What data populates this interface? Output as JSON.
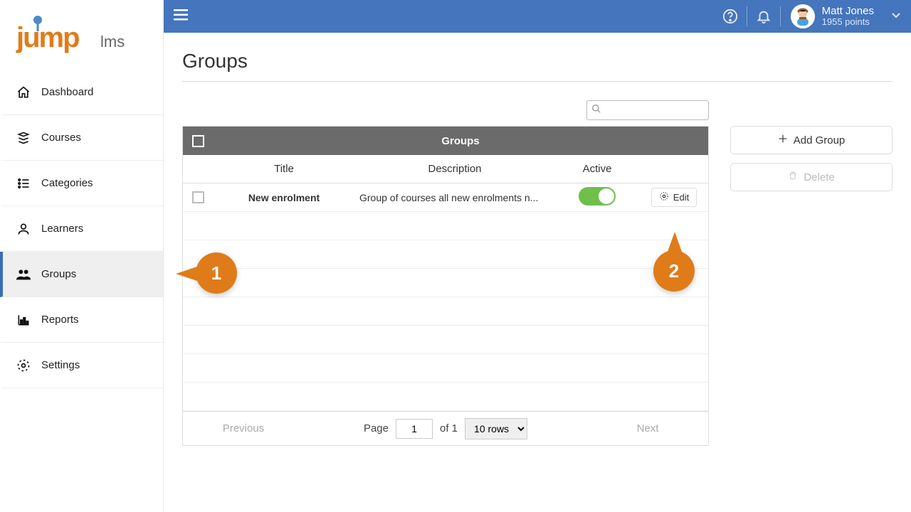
{
  "brand": {
    "name": "jump",
    "suffix": "lms"
  },
  "sidebar": {
    "items": [
      {
        "label": "Dashboard",
        "icon": "home"
      },
      {
        "label": "Courses",
        "icon": "stack"
      },
      {
        "label": "Categories",
        "icon": "list"
      },
      {
        "label": "Learners",
        "icon": "person"
      },
      {
        "label": "Groups",
        "icon": "group",
        "active": true
      },
      {
        "label": "Reports",
        "icon": "bars"
      },
      {
        "label": "Settings",
        "icon": "gear"
      }
    ]
  },
  "topbar": {
    "user_name": "Matt Jones",
    "user_points": "1955 points"
  },
  "page": {
    "title": "Groups"
  },
  "search": {
    "placeholder": ""
  },
  "table": {
    "header_title": "Groups",
    "columns": {
      "title": "Title",
      "description": "Description",
      "active": "Active"
    },
    "rows": [
      {
        "title": "New enrolment",
        "description": "Group of courses all new enrolments n...",
        "active": true
      }
    ],
    "edit_label": "Edit"
  },
  "pager": {
    "prev": "Previous",
    "next": "Next",
    "page_label": "Page",
    "page_value": "1",
    "of_label": "of 1",
    "rows_label": "10 rows"
  },
  "actions": {
    "add_group": "Add Group",
    "delete": "Delete"
  },
  "callouts": {
    "one": "1",
    "two": "2"
  }
}
